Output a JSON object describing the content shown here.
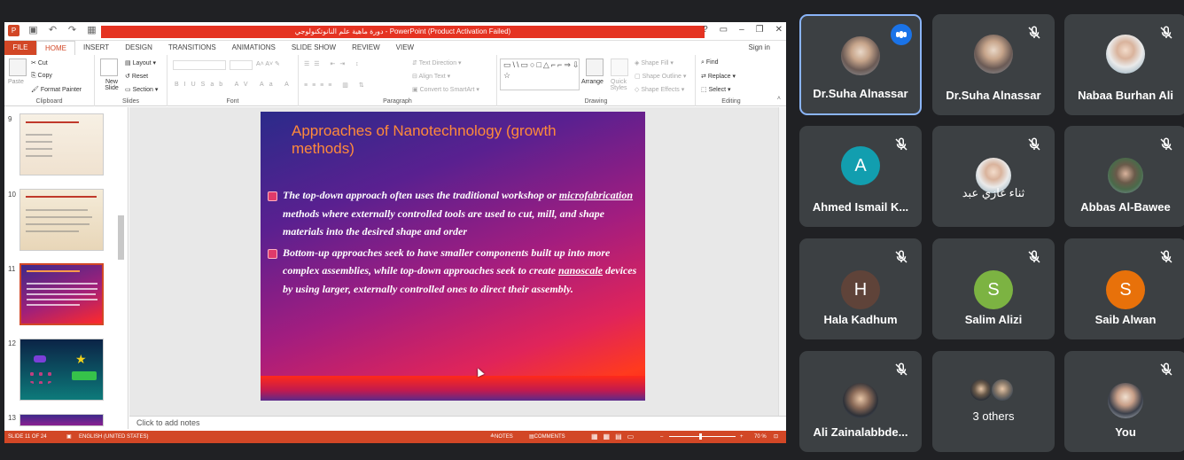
{
  "ppt": {
    "title": "دورة ماهية علم النانوتكنولوجي - PowerPoint (Product Activation Failed)",
    "sign_in": "Sign in",
    "tabs": [
      "FILE",
      "HOME",
      "INSERT",
      "DESIGN",
      "TRANSITIONS",
      "ANIMATIONS",
      "SLIDE SHOW",
      "REVIEW",
      "VIEW"
    ],
    "active_tab": "HOME",
    "ribbon": {
      "clipboard": {
        "paste": "Paste",
        "cut": "Cut",
        "copy": "Copy",
        "format_painter": "Format Painter",
        "label": "Clipboard"
      },
      "slides": {
        "new_slide": "New Slide",
        "layout": "Layout",
        "reset": "Reset",
        "section": "Section",
        "label": "Slides"
      },
      "font": {
        "label": "Font"
      },
      "paragraph": {
        "text_direction": "Text Direction",
        "align_text": "Align Text",
        "convert": "Convert to SmartArt",
        "label": "Paragraph"
      },
      "drawing": {
        "arrange": "Arrange",
        "quick_styles": "Quick Styles",
        "shape_fill": "Shape Fill",
        "shape_outline": "Shape Outline",
        "shape_effects": "Shape Effects",
        "label": "Drawing"
      },
      "editing": {
        "find": "Find",
        "replace": "Replace",
        "select": "Select",
        "label": "Editing"
      }
    },
    "thumbnails": [
      {
        "num": "9"
      },
      {
        "num": "10"
      },
      {
        "num": "11"
      },
      {
        "num": "12"
      },
      {
        "num": "13"
      }
    ],
    "slide": {
      "title": "Approaches of Nanotechnology (growth methods)",
      "bullet1_a": "The top-down approach often uses the traditional workshop or ",
      "bullet1_u": "microfabrication",
      "bullet1_b": " methods where externally controlled tools are used to cut, mill, and shape materials into the desired shape and order",
      "bullet2_a": "Bottom-up approaches seek to have smaller components built up into more complex assemblies, while top-down approaches seek to create ",
      "bullet2_u": "nanoscale",
      "bullet2_b": " devices by using larger, externally controlled ones to direct their assembly."
    },
    "notes_placeholder": "Click to add notes",
    "status": {
      "slide": "SLIDE 11 OF 24",
      "language": "ENGLISH (UNITED STATES)",
      "notes": "NOTES",
      "comments": "COMMENTS",
      "zoom": "70 %"
    }
  },
  "participants": [
    {
      "name": "Dr.Suha Alnassar",
      "speaking": true
    },
    {
      "name": "Dr.Suha Alnassar",
      "speaking": false
    },
    {
      "name": "Nabaa Burhan Ali",
      "speaking": false
    },
    {
      "name": "Ahmed Ismail K...",
      "initial": "A",
      "color": "#129eaf"
    },
    {
      "name": "ثناء غازي عبد"
    },
    {
      "name": "Abbas Al-Bawee"
    },
    {
      "name": "Hala Kadhum",
      "initial": "H",
      "color": "#5f4339"
    },
    {
      "name": "Salim Alizi",
      "initial": "S",
      "color": "#7cb342"
    },
    {
      "name": "Saib Alwan",
      "initial": "S",
      "color": "#e8710a"
    },
    {
      "name": "Ali Zainalabbde..."
    },
    {
      "name": "3 others"
    },
    {
      "name": "You"
    }
  ]
}
